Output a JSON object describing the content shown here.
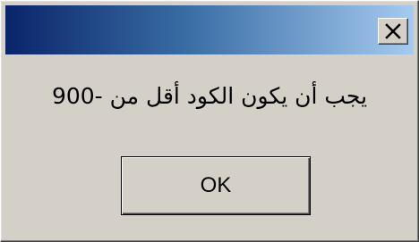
{
  "dialog": {
    "title": "",
    "message": "يجب أن يكون الكود أقل من -900",
    "ok_label": "OK",
    "close_icon": "close-icon"
  },
  "colors": {
    "titlebar_start": "#0a246a",
    "titlebar_end": "#a6caf0",
    "face": "#d4d0c8"
  }
}
